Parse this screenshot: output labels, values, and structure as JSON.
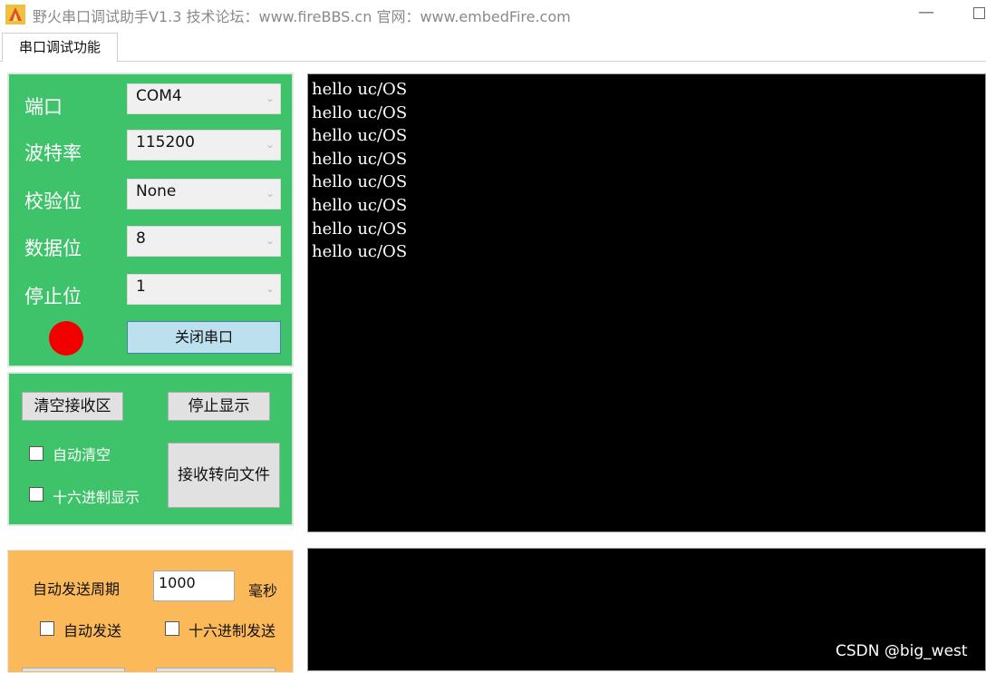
{
  "window": {
    "title": "野火串口调试助手V1.3    技术论坛：www.fireBBS.cn   官网：www.embedFire.com",
    "minimize_glyph": "—"
  },
  "tabs": [
    {
      "label": "串口调试功能"
    }
  ],
  "serial_config": {
    "port": {
      "label": "端口",
      "value": "COM4"
    },
    "baud": {
      "label": "波特率",
      "value": "115200"
    },
    "parity": {
      "label": "校验位",
      "value": "None"
    },
    "data_bits": {
      "label": "数据位",
      "value": "8"
    },
    "stop_bits": {
      "label": "停止位",
      "value": "1"
    },
    "status_color": "#f20000",
    "close_button_label": "关闭串口"
  },
  "receive_controls": {
    "clear_button_label": "清空接收区",
    "stop_display_button_label": "停止显示",
    "auto_clear_label": "自动清空",
    "hex_display_label": "十六进制显示",
    "redirect_button_label": "接收转向文件"
  },
  "send_controls": {
    "auto_send_period_label": "自动发送周期",
    "period_value": "1000",
    "period_unit": "毫秒",
    "auto_send_label": "自动发送",
    "hex_send_label": "十六进制发送"
  },
  "receive_console": {
    "lines": [
      "hello uc/OS",
      "hello uc/OS",
      "hello uc/OS",
      "hello uc/OS",
      "hello uc/OS",
      "hello uc/OS",
      "hello uc/OS",
      "hello uc/OS"
    ]
  },
  "watermark": "CSDN @big_west",
  "colors": {
    "panel_green": "#3fc36a",
    "panel_orange": "#fbb95a",
    "console_bg": "#000000"
  }
}
